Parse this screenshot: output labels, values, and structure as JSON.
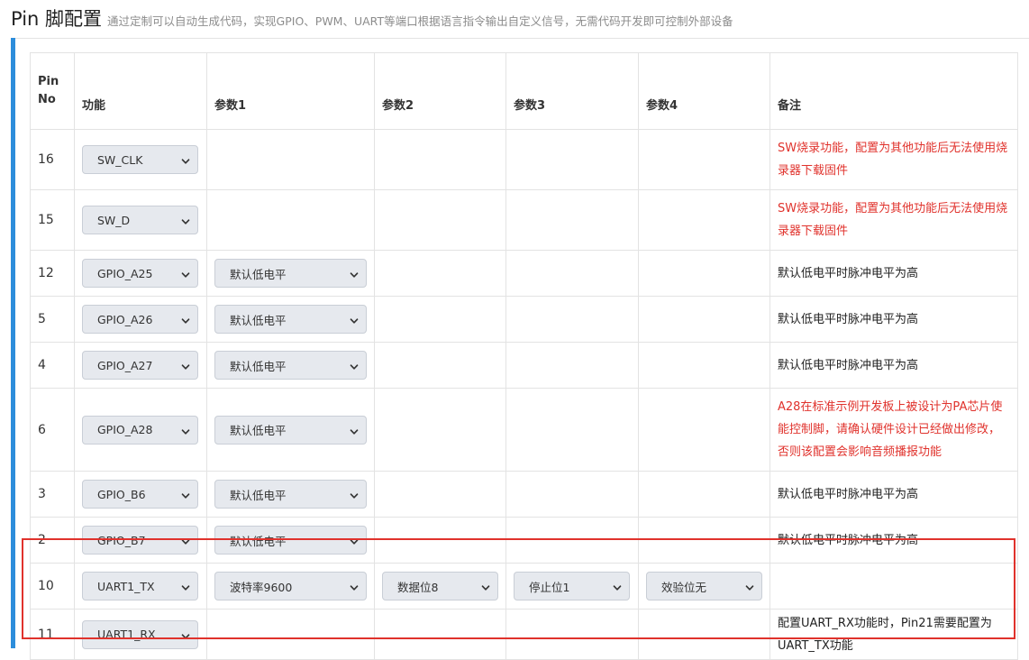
{
  "header": {
    "title": "Pin 脚配置",
    "subtitle": "通过定制可以自动生成代码，实现GPIO、PWM、UART等端口根据语言指令输出自定义信号，无需代码开发即可控制外部设备"
  },
  "table": {
    "columns": [
      "Pin No",
      "功能",
      "参数1",
      "参数2",
      "参数3",
      "参数4",
      "备注"
    ],
    "rows": [
      {
        "pin": "16",
        "func": "SW_CLK",
        "p1": "",
        "p2": "",
        "p3": "",
        "p4": "",
        "note": "SW烧录功能，配置为其他功能后无法使用烧录器下载固件",
        "note_type": "warn"
      },
      {
        "pin": "15",
        "func": "SW_D",
        "p1": "",
        "p2": "",
        "p3": "",
        "p4": "",
        "note": "SW烧录功能，配置为其他功能后无法使用烧录器下载固件",
        "note_type": "warn"
      },
      {
        "pin": "12",
        "func": "GPIO_A25",
        "p1": "默认低电平",
        "p2": "",
        "p3": "",
        "p4": "",
        "note": "默认低电平时脉冲电平为高",
        "note_type": "info"
      },
      {
        "pin": "5",
        "func": "GPIO_A26",
        "p1": "默认低电平",
        "p2": "",
        "p3": "",
        "p4": "",
        "note": "默认低电平时脉冲电平为高",
        "note_type": "info"
      },
      {
        "pin": "4",
        "func": "GPIO_A27",
        "p1": "默认低电平",
        "p2": "",
        "p3": "",
        "p4": "",
        "note": "默认低电平时脉冲电平为高",
        "note_type": "info"
      },
      {
        "pin": "6",
        "func": "GPIO_A28",
        "p1": "默认低电平",
        "p2": "",
        "p3": "",
        "p4": "",
        "note": "A28在标准示例开发板上被设计为PA芯片使能控制脚，请确认硬件设计已经做出修改，否则该配置会影响音频播报功能",
        "note_type": "warn"
      },
      {
        "pin": "3",
        "func": "GPIO_B6",
        "p1": "默认低电平",
        "p2": "",
        "p3": "",
        "p4": "",
        "note": "默认低电平时脉冲电平为高",
        "note_type": "info"
      },
      {
        "pin": "2",
        "func": "GPIO_B7",
        "p1": "默认低电平",
        "p2": "",
        "p3": "",
        "p4": "",
        "note": "默认低电平时脉冲电平为高",
        "note_type": "info"
      },
      {
        "pin": "10",
        "func": "UART1_TX",
        "p1": "波特率9600",
        "p2": "数据位8",
        "p3": "停止位1",
        "p4": "效验位无",
        "note": "",
        "note_type": "info"
      },
      {
        "pin": "11",
        "func": "UART1_RX",
        "p1": "",
        "p2": "",
        "p3": "",
        "p4": "",
        "note": "配置UART_RX功能时，Pin21需要配置为UART_TX功能",
        "note_type": "info"
      }
    ]
  },
  "colors": {
    "accent": "#2d8ddb",
    "warning": "#e0322c",
    "highlight": "#e0322c"
  }
}
